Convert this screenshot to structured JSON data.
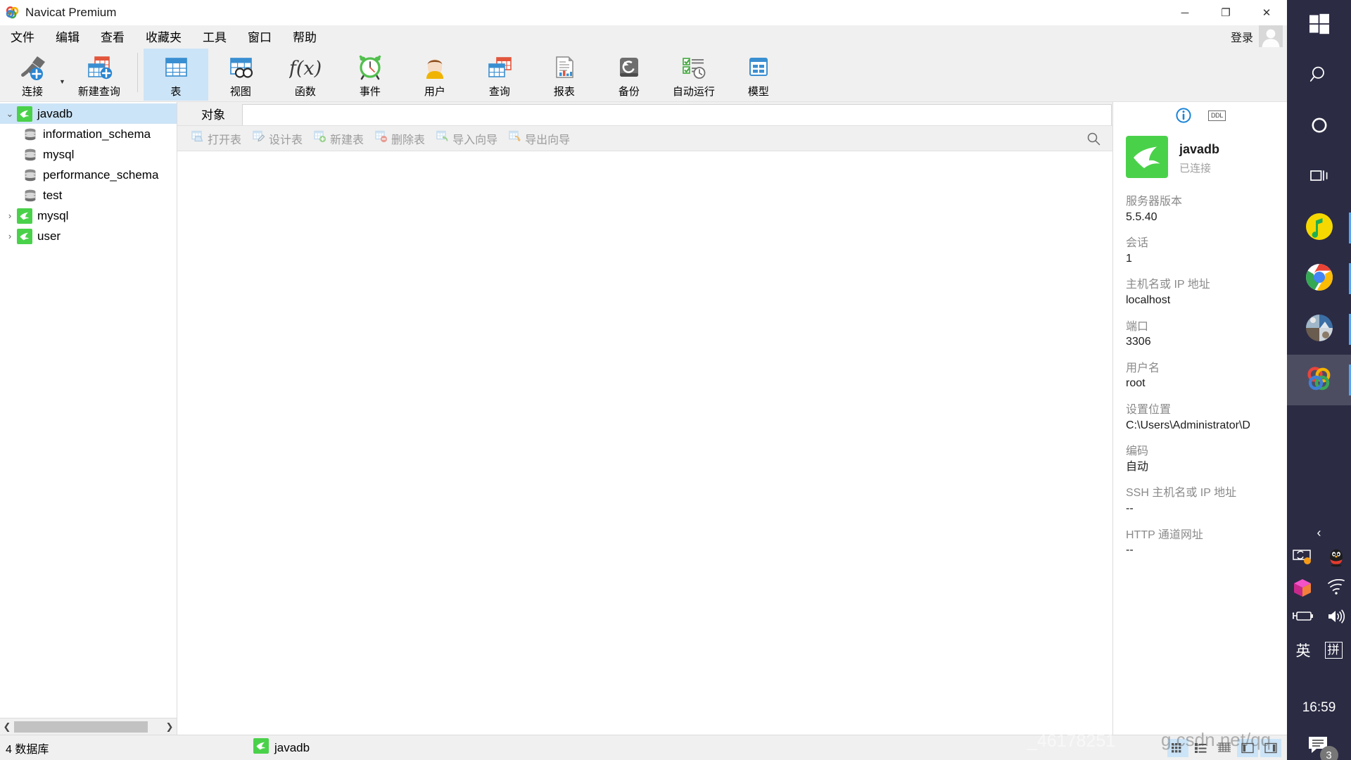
{
  "window": {
    "title": "Navicat Premium",
    "app_icon": "navicat-logo-icon",
    "minimize_glyph": "─",
    "maximize_glyph": "❐",
    "close_glyph": "✕"
  },
  "menubar": {
    "items": [
      {
        "label": "文件",
        "name": "menu-file"
      },
      {
        "label": "编辑",
        "name": "menu-edit"
      },
      {
        "label": "查看",
        "name": "menu-view"
      },
      {
        "label": "收藏夹",
        "name": "menu-favorites"
      },
      {
        "label": "工具",
        "name": "menu-tools"
      },
      {
        "label": "窗口",
        "name": "menu-window"
      },
      {
        "label": "帮助",
        "name": "menu-help"
      }
    ],
    "login_label": "登录"
  },
  "ribbon": {
    "items": [
      {
        "label": "连接",
        "icon": "connection-icon",
        "selected": false
      },
      {
        "label": "新建查询",
        "icon": "new-query-icon",
        "selected": false
      },
      {
        "label": "表",
        "icon": "table-icon",
        "selected": true
      },
      {
        "label": "视图",
        "icon": "view-icon",
        "selected": false
      },
      {
        "label": "函数",
        "icon": "function-icon",
        "selected": false
      },
      {
        "label": "事件",
        "icon": "event-clock-icon",
        "selected": false
      },
      {
        "label": "用户",
        "icon": "user-icon",
        "selected": false
      },
      {
        "label": "查询",
        "icon": "query-icon",
        "selected": false
      },
      {
        "label": "报表",
        "icon": "report-icon",
        "selected": false
      },
      {
        "label": "备份",
        "icon": "backup-icon",
        "selected": false
      },
      {
        "label": "自动运行",
        "icon": "automation-icon",
        "selected": false
      },
      {
        "label": "模型",
        "icon": "model-icon",
        "selected": false
      }
    ]
  },
  "tree": {
    "nodes": [
      {
        "label": "javadb",
        "icon": "mysql-connection-icon",
        "level": 0,
        "expanded": true,
        "selected": true
      },
      {
        "label": "information_schema",
        "icon": "database-icon",
        "level": 1,
        "expanded": null,
        "selected": false
      },
      {
        "label": "mysql",
        "icon": "database-icon",
        "level": 1,
        "expanded": null,
        "selected": false
      },
      {
        "label": "performance_schema",
        "icon": "database-icon",
        "level": 1,
        "expanded": null,
        "selected": false
      },
      {
        "label": "test",
        "icon": "database-icon",
        "level": 1,
        "expanded": null,
        "selected": false
      },
      {
        "label": "mysql",
        "icon": "mysql-connection-icon",
        "level": 0,
        "expanded": false,
        "selected": false
      },
      {
        "label": "user",
        "icon": "mysql-connection-icon",
        "level": 0,
        "expanded": false,
        "selected": false
      }
    ]
  },
  "main": {
    "tabs": [
      {
        "label": "对象",
        "active": true
      }
    ],
    "object_toolbar": [
      {
        "label": "打开表",
        "icon": "open-table-icon"
      },
      {
        "label": "设计表",
        "icon": "design-table-icon"
      },
      {
        "label": "新建表",
        "icon": "new-table-icon"
      },
      {
        "label": "删除表",
        "icon": "delete-table-icon"
      },
      {
        "label": "导入向导",
        "icon": "import-wizard-icon"
      },
      {
        "label": "导出向导",
        "icon": "export-wizard-icon"
      }
    ],
    "search_icon": "search-icon"
  },
  "info_panel": {
    "tab_info_icon": "info-icon",
    "tab_ddl_label": "DDL",
    "connection_name": "javadb",
    "connection_state": "已连接",
    "fields": [
      {
        "key": "服务器版本",
        "value": "5.5.40"
      },
      {
        "key": "会话",
        "value": "1"
      },
      {
        "key": "主机名或 IP 地址",
        "value": "localhost"
      },
      {
        "key": "端口",
        "value": "3306"
      },
      {
        "key": "用户名",
        "value": "root"
      },
      {
        "key": "设置位置",
        "value": "C:\\Users\\Administrator\\D"
      },
      {
        "key": "编码",
        "value": "自动"
      },
      {
        "key": "SSH 主机名或 IP 地址",
        "value": "--"
      },
      {
        "key": "HTTP 通道网址",
        "value": "--"
      }
    ]
  },
  "statusbar": {
    "left_text": "4 数据库",
    "connection_label": "javadb",
    "view_buttons": [
      {
        "name": "grid-view",
        "icon": "grid-view-icon",
        "active": true
      },
      {
        "name": "list-view",
        "icon": "list-view-icon",
        "active": false
      },
      {
        "name": "detail-view",
        "icon": "detail-view-icon",
        "active": false
      },
      {
        "name": "split-horizontal",
        "icon": "split-horizontal-icon",
        "active": true
      },
      {
        "name": "split-vertical",
        "icon": "split-vertical-icon",
        "active": true
      }
    ]
  },
  "taskbar": {
    "items": [
      {
        "name": "start-button",
        "icon": "windows-logo-icon"
      },
      {
        "name": "search-button",
        "icon": "search-icon"
      },
      {
        "name": "cortana-button",
        "icon": "cortana-circle-icon"
      },
      {
        "name": "task-view-button",
        "icon": "task-view-icon"
      },
      {
        "name": "qqmusic-button",
        "icon": "qq-music-icon"
      },
      {
        "name": "chrome-button",
        "icon": "chrome-icon"
      },
      {
        "name": "photos-button",
        "icon": "photos-icon"
      },
      {
        "name": "navicat-button",
        "icon": "navicat-logo-icon"
      }
    ],
    "tray": {
      "chevron": "‹",
      "icons": [
        {
          "name": "onedrive-sync-icon"
        },
        {
          "name": "qq-penguin-icon"
        },
        {
          "name": "cube-icon"
        },
        {
          "name": "wifi-icon"
        },
        {
          "name": "battery-icon"
        },
        {
          "name": "volume-icon"
        }
      ],
      "ime_mode": "英",
      "ime_pinyin": "拼",
      "clock": "16:59",
      "notification_count": "3"
    }
  },
  "watermark": {
    "text": "_46178251",
    "text2": "g.csdn.net/qq"
  }
}
